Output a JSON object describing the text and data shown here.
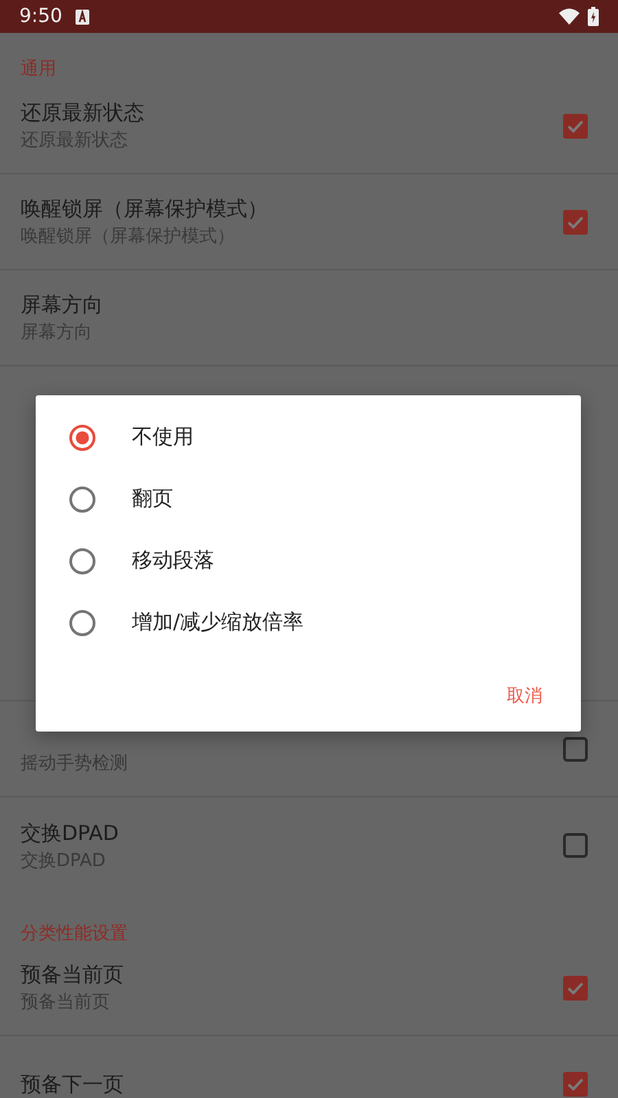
{
  "status_bar": {
    "time": "9:50"
  },
  "settings": {
    "above_dialog": [
      {
        "kind": "section",
        "title": "通用"
      },
      {
        "kind": "checkbox",
        "title": "还原最新状态",
        "subtitle": "还原最新状态",
        "checked": true
      },
      {
        "kind": "checkbox",
        "title": "唤醒锁屏（屏幕保护模式）",
        "subtitle": "唤醒锁屏（屏幕保护模式）",
        "checked": true
      },
      {
        "kind": "plain",
        "title": "屏幕方向",
        "subtitle": "屏幕方向"
      }
    ],
    "below_dialog": [
      {
        "kind": "checkbox",
        "subtitle": "摇动手势检测",
        "checked": false
      },
      {
        "kind": "checkbox",
        "title": "交换DPAD",
        "subtitle": "交换DPAD",
        "checked": false
      },
      {
        "kind": "section",
        "title": "分类性能设置"
      },
      {
        "kind": "checkbox",
        "title": "预备当前页",
        "subtitle": "预备当前页",
        "checked": true
      },
      {
        "kind": "checkbox",
        "title": "预备下一页",
        "checked": true
      }
    ]
  },
  "dialog": {
    "options": [
      {
        "label": "不使用",
        "selected": true
      },
      {
        "label": "翻页",
        "selected": false
      },
      {
        "label": "移动段落",
        "selected": false
      },
      {
        "label": "增加/减少缩放倍率",
        "selected": false
      }
    ],
    "cancel": "取消"
  }
}
